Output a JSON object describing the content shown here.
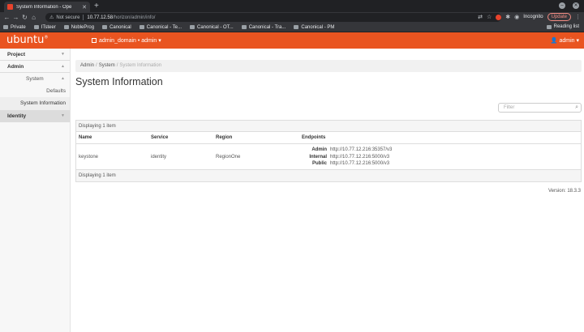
{
  "browser": {
    "tab_title": "System Information - Ope",
    "new_tab": "+",
    "not_secure": "Not secure",
    "url_host": "10.77.12.58",
    "url_path": "/horizon/admin/info/",
    "incognito": "Incognito",
    "update": "Update",
    "reading_list": "Reading list",
    "bookmarks": [
      "Private",
      "ITsteer",
      "NobleProg",
      "Canonical",
      "Canonical - Te...",
      "Canonical - OT...",
      "Canonical - Tra...",
      "Canonical - PM"
    ]
  },
  "header": {
    "logo": "ubuntu",
    "logo_mark": "®",
    "project_menu": "admin_domain • admin ▾",
    "user_menu": "admin ▾"
  },
  "sidebar": {
    "project": "Project",
    "admin": "Admin",
    "system": "System",
    "defaults": "Defaults",
    "system_information": "System Information",
    "identity": "Identity"
  },
  "breadcrumb": [
    "Admin",
    "System",
    "System Information"
  ],
  "page_title": "System Information",
  "filter_placeholder": "Filter",
  "table": {
    "caption": "Displaying 1 item",
    "headers": [
      "Name",
      "Service",
      "Region",
      "Endpoints"
    ],
    "row": {
      "name": "keystone",
      "service": "identity",
      "region": "RegionOne",
      "endpoints": [
        {
          "name": "Admin",
          "url": "http://10.77.12.216:35357/v3"
        },
        {
          "name": "Internal",
          "url": "http://10.77.12.216:5000/v3"
        },
        {
          "name": "Public",
          "url": "http://10.77.12.216:5000/v3"
        }
      ]
    },
    "footer": "Displaying 1 item"
  },
  "version": "Version: 18.3.3",
  "colors": {
    "brand": "#e95420",
    "chrome_dark": "#202124"
  }
}
